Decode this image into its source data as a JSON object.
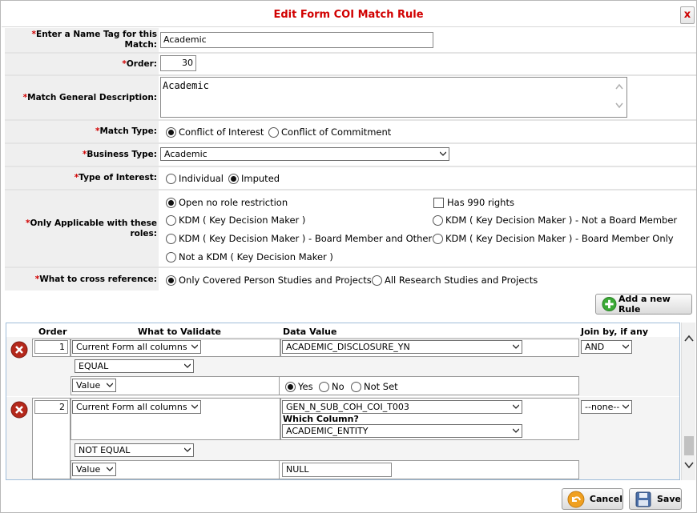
{
  "dialog": {
    "title": "Edit Form COI Match Rule",
    "close_label": "x"
  },
  "form": {
    "name_tag": {
      "label": "Enter a Name Tag for this Match:",
      "value": "Academic"
    },
    "order": {
      "label": "Order:",
      "value": "30"
    },
    "description": {
      "label": "Match General Description:",
      "value": "Academic"
    },
    "match_type": {
      "label": "Match Type:",
      "options": [
        "Conflict of Interest",
        "Conflict of Commitment"
      ],
      "selected": "Conflict of Interest"
    },
    "business_type": {
      "label": "Business Type:",
      "value": "Academic"
    },
    "type_of_interest": {
      "label": "Type of Interest:",
      "options": [
        "Individual",
        "Imputed"
      ],
      "selected": "Imputed"
    },
    "roles": {
      "label": "Only Applicable with these roles:",
      "options": [
        "Open no role restriction",
        "Has 990 rights",
        "KDM ( Key Decision Maker )",
        "KDM ( Key Decision Maker ) - Not a Board Member",
        "KDM ( Key Decision Maker ) - Board Member and Other",
        "KDM ( Key Decision Maker ) - Board Member Only",
        "Not a KDM ( Key Decision Maker )"
      ],
      "selected": "Open no role restriction"
    },
    "cross_reference": {
      "label": "What to cross reference:",
      "options": [
        "Only Covered Person Studies and Projects",
        "All Research Studies and Projects"
      ],
      "selected": "Only Covered Person Studies and Projects"
    }
  },
  "required_marker": "*",
  "add_rule_label": "Add a new Rule",
  "rules_table": {
    "headers": [
      "Order",
      "What to Validate",
      "Data Value",
      "Join by, if any"
    ],
    "rules": [
      {
        "order": "1",
        "validate": "Current Form all columns",
        "data_value": "ACADEMIC_DISCLOSURE_YN",
        "join": "AND",
        "operator": "EQUAL",
        "value_type": "Value",
        "value_options": [
          "Yes",
          "No",
          "Not Set"
        ],
        "value_selected": "Yes"
      },
      {
        "order": "2",
        "validate": "Current Form all columns",
        "data_value": "GEN_N_SUB_COH_COI_T003",
        "which_column_label": "Which Column?",
        "which_column": "ACADEMIC_ENTITY",
        "join": "--none--",
        "operator": "NOT EQUAL",
        "value_type": "Value",
        "value_text": "NULL"
      }
    ]
  },
  "footer": {
    "cancel_label": "Cancel",
    "save_label": "Save"
  },
  "colors": {
    "title_red": "#d10000",
    "label_bg": "#efefef",
    "add_icon_green": "#3aa935",
    "delete_icon_red": "#b5281b"
  }
}
